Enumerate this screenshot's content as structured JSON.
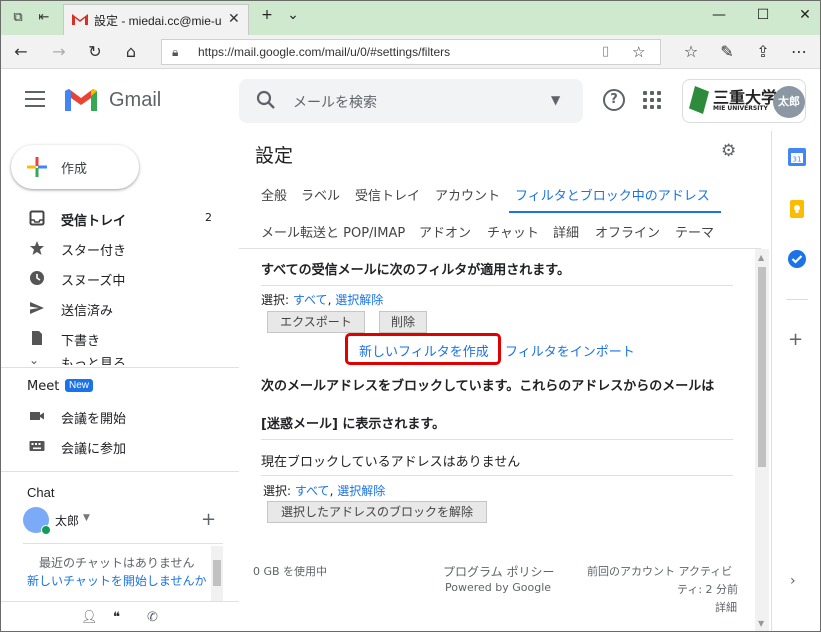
{
  "browser": {
    "tab_title": "設定 - miedai.cc@mie-u",
    "url": "https://mail.google.com/mail/u/0/#settings/filters"
  },
  "header": {
    "app_name": "Gmail",
    "search_placeholder": "メールを検索",
    "org_logo_text": "三重大学",
    "org_logo_sub": "MIE UNIVERSITY",
    "avatar_text": "太郎"
  },
  "sidebar": {
    "compose_label": "作成",
    "items": [
      {
        "label": "受信トレイ",
        "count": "2"
      },
      {
        "label": "スター付き"
      },
      {
        "label": "スヌーズ中"
      },
      {
        "label": "送信済み"
      },
      {
        "label": "下書き"
      },
      {
        "label": "もっと見る"
      }
    ],
    "meet": {
      "title": "Meet",
      "badge": "New",
      "items": [
        "会議を開始",
        "会議に参加"
      ]
    },
    "chat": {
      "title": "Chat",
      "user": "太郎",
      "empty_text": "最近のチャットはありません",
      "start_link": "新しいチャットを開始しませんか"
    }
  },
  "settings": {
    "title": "設定",
    "tabs_row1": [
      "全般",
      "ラベル",
      "受信トレイ",
      "アカウント",
      "フィルタとブロック中のアドレス"
    ],
    "tabs_row2": [
      "メール転送と POP/IMAP",
      "アドオン",
      "チャット",
      "詳細",
      "オフライン",
      "テーマ"
    ],
    "active_tab": "フィルタとブロック中のアドレス",
    "filters_heading": "すべての受信メールに次のフィルタが適用されます。",
    "select_label": "選択:",
    "select_all": "すべて",
    "select_none": "選択解除",
    "export_button": "エクスポート",
    "delete_button": "削除",
    "create_filter": "新しいフィルタを作成",
    "import_filters": "フィルタをインポート",
    "blocked_heading_1": "次のメールアドレスをブロックしています。これらのアドレスからのメールは",
    "blocked_heading_2": "[迷惑メール] に表示されます。",
    "no_blocked": "現在ブロックしているアドレスはありません",
    "unblock_button": "選択したアドレスのブロックを解除",
    "footer": {
      "storage": "0 GB を使用中",
      "policy": "プログラム ポリシー",
      "powered": "Powered by Google",
      "activity_1": "前回のアカウント アクティビ",
      "activity_2": "ティ: 2 分前",
      "details": "詳細"
    }
  },
  "colors": {
    "accent": "#1a73e8",
    "highlight_box": "#e00000",
    "tabbar_bg": "#cfe9cf"
  }
}
